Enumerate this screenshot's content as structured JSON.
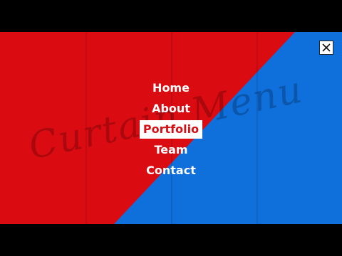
{
  "colors": {
    "letterbox": "#000000",
    "curtain_red": "#db0b12",
    "curtain_blue": "#0f6fdb",
    "panel_divider": "rgba(0,0,0,0.22)",
    "active_text": "#d50f14"
  },
  "watermark": {
    "text": "Curtain Menu"
  },
  "close_button": {
    "icon": "close-icon"
  },
  "menu": {
    "items": [
      {
        "label": "Home",
        "active": false
      },
      {
        "label": "About",
        "active": false
      },
      {
        "label": "Portfolio",
        "active": true
      },
      {
        "label": "Team",
        "active": false
      },
      {
        "label": "Contact",
        "active": false
      }
    ]
  }
}
